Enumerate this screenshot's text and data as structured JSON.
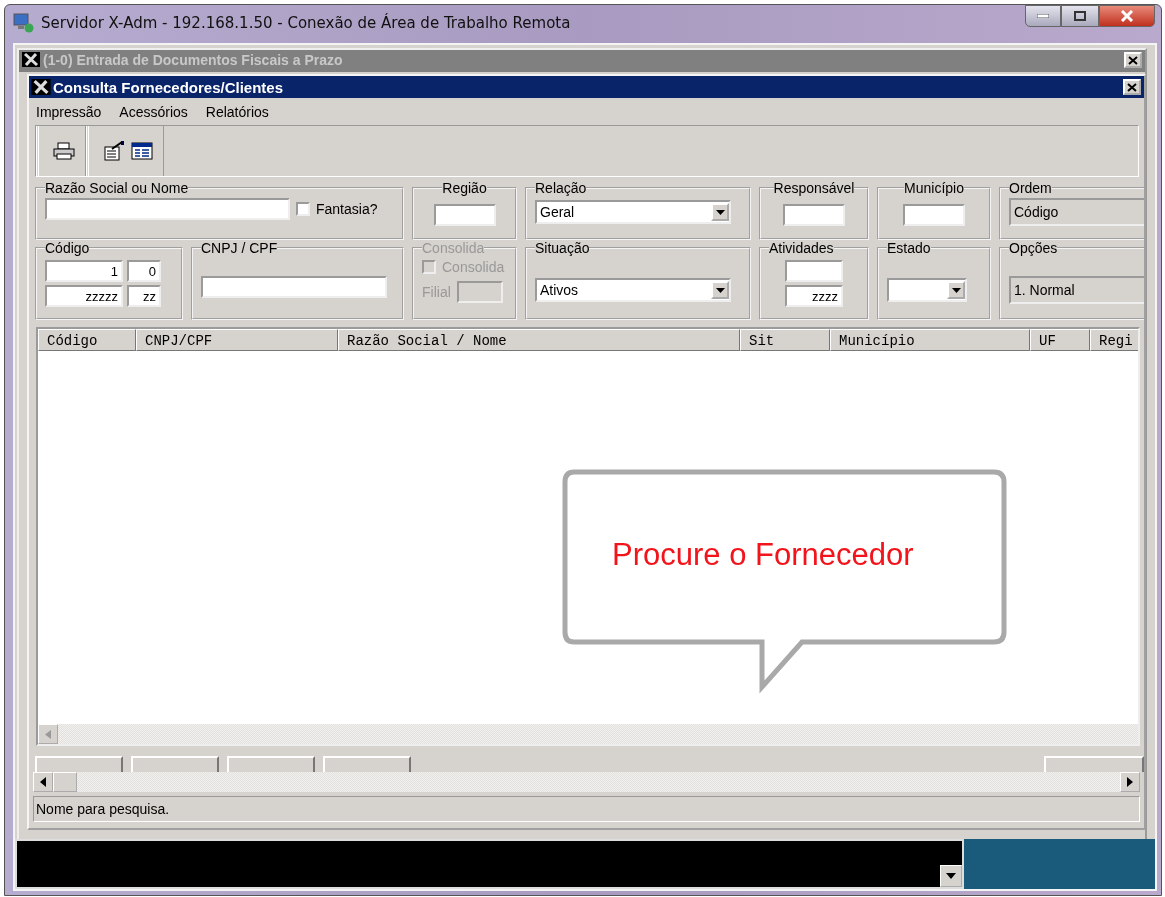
{
  "remote_window": {
    "title": "Servidor X-Adm - 192.168.1.50 - Conexão de Área de Trabalho Remota"
  },
  "back_window": {
    "title": "(1-0) Entrada de Documentos Fiscais a Prazo",
    "active": false
  },
  "dialog": {
    "title": "Consulta Fornecedores/Clientes",
    "active": true
  },
  "menu": [
    "Impressão",
    "Acessórios",
    "Relatórios"
  ],
  "filters": [
    {
      "kind": "name",
      "label": "Razão Social ou Nome",
      "check_label": "Fantasia?",
      "checked": false
    },
    {
      "kind": "text",
      "label": "Região"
    },
    {
      "kind": "combo",
      "label": "Relação",
      "value": "Geral"
    },
    {
      "kind": "text",
      "label": "Responsável"
    },
    {
      "kind": "text",
      "label": "Município"
    },
    {
      "kind": "readonly",
      "label": "Ordem",
      "value": "Código"
    },
    {
      "kind": "code",
      "label": "Código",
      "from": [
        "1",
        "0"
      ],
      "to": [
        "zzzzz",
        "zz"
      ]
    },
    {
      "kind": "wide",
      "label": "CNPJ / CPF"
    },
    {
      "kind": "consolida",
      "label": "Consolida",
      "check_label": "Consolida",
      "filial_label": "Filial",
      "disabled": true,
      "checked": false
    },
    {
      "kind": "combo",
      "label": "Situação",
      "value": "Ativos"
    },
    {
      "kind": "range",
      "label": "Atividades",
      "to": "zzzz"
    },
    {
      "kind": "combo",
      "label": "Estado"
    },
    {
      "kind": "readonly",
      "label": "Opções",
      "value": "1. Normal"
    }
  ],
  "table": {
    "columns": [
      "Código",
      "CNPJ/CPF",
      "Razão Social / Nome",
      "Sit",
      "Município",
      "UF",
      "Regi"
    ]
  },
  "callout": {
    "text": "Procure o Fornecedor"
  },
  "status_bar": {
    "text": "Nome para pesquisa."
  }
}
